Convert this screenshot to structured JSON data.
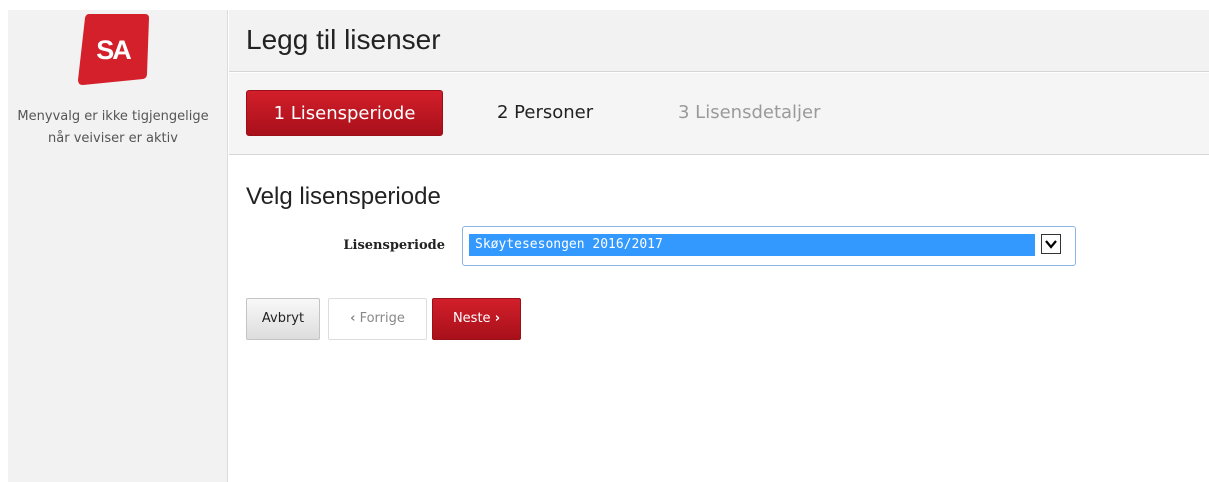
{
  "brand": {
    "logo_text": "SA",
    "accent_color": "#c8161e"
  },
  "sidebar": {
    "note": "Menyvalg er ikke tigjengelige når veiviser er aktiv"
  },
  "header": {
    "title": "Legg til lisenser"
  },
  "steps": [
    {
      "label": "1 Lisensperiode",
      "state": "active"
    },
    {
      "label": "2 Personer",
      "state": "enabled"
    },
    {
      "label": "3 Lisensdetaljer",
      "state": "disabled"
    }
  ],
  "main": {
    "section_title": "Velg lisensperiode",
    "field_label": "Lisensperiode",
    "select_value": "Skøytesesongen 2016/2017"
  },
  "buttons": {
    "cancel": "Avbryt",
    "previous": "Forrige",
    "next": "Neste"
  },
  "icons": {
    "previous": "chevron-left-icon",
    "next": "chevron-right-icon",
    "dropdown": "chevron-down-icon"
  }
}
